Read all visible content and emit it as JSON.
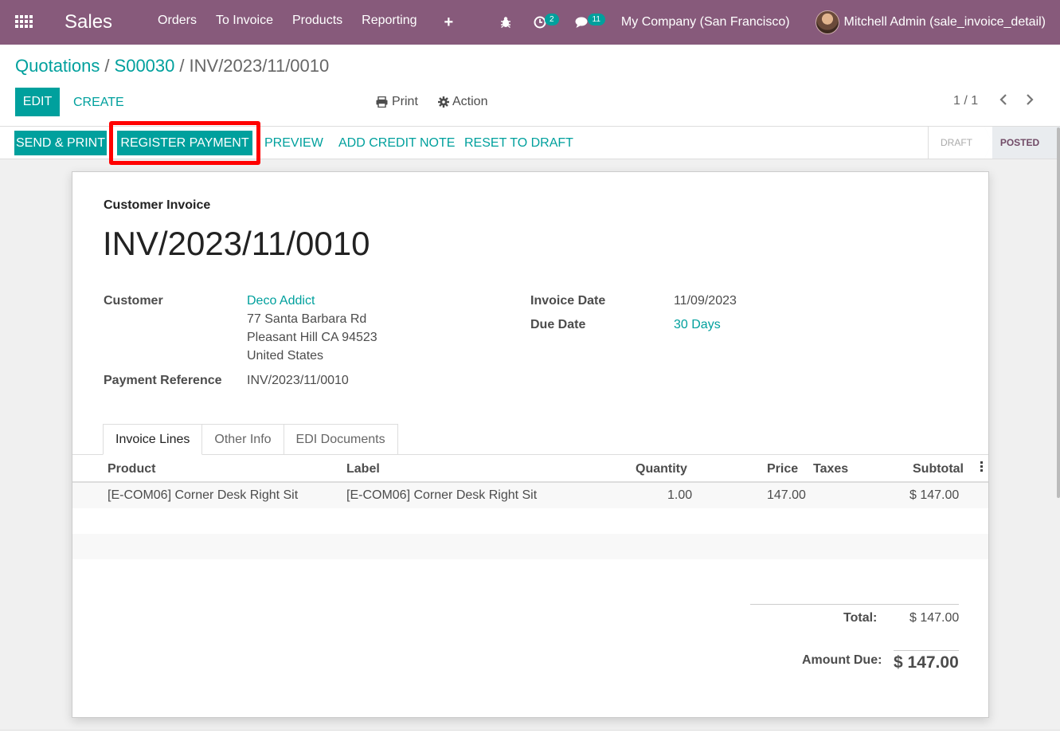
{
  "navbar": {
    "app_name": "Sales",
    "menu": [
      "Orders",
      "To Invoice",
      "Products",
      "Reporting"
    ],
    "plus": "+",
    "activity_count": "2",
    "message_count": "11",
    "company": "My Company (San Francisco)",
    "user": "Mitchell Admin (sale_invoice_detail)",
    "color": "#875a7b"
  },
  "breadcrumb": {
    "items": [
      "Quotations",
      "S00030"
    ],
    "current": "INV/2023/11/0010"
  },
  "control": {
    "edit_label": "EDIT",
    "create_label": "CREATE",
    "print_label": "Print",
    "action_label": "Action",
    "pager": "1 / 1"
  },
  "statusbar": {
    "send_print": "SEND & PRINT",
    "register_payment": "REGISTER PAYMENT",
    "preview": "PREVIEW",
    "add_credit_note": "ADD CREDIT NOTE",
    "reset_to_draft": "RESET TO DRAFT",
    "stages": [
      "DRAFT",
      "POSTED"
    ],
    "active_stage": "POSTED",
    "accent": "#00a09d"
  },
  "invoice": {
    "type": "Customer Invoice",
    "name": "INV/2023/11/0010",
    "customer_label": "Customer",
    "customer_name": "Deco Addict",
    "customer_address": [
      "77 Santa Barbara Rd",
      "Pleasant Hill CA 94523",
      "United States"
    ],
    "payment_ref_label": "Payment Reference",
    "payment_ref": "INV/2023/11/0010",
    "invoice_date_label": "Invoice Date",
    "invoice_date": "11/09/2023",
    "due_date_label": "Due Date",
    "due_date": "30 Days"
  },
  "tabs": [
    "Invoice Lines",
    "Other Info",
    "EDI Documents"
  ],
  "lines": {
    "columns": [
      "Product",
      "Label",
      "Quantity",
      "Price",
      "Taxes",
      "Subtotal"
    ],
    "rows": [
      {
        "product": "[E-COM06] Corner Desk Right Sit",
        "label": "[E-COM06] Corner Desk Right Sit",
        "quantity": "1.00",
        "price": "147.00",
        "taxes": "",
        "subtotal": "$ 147.00"
      }
    ]
  },
  "totals": {
    "total_label": "Total:",
    "total": "$ 147.00",
    "amount_due_label": "Amount Due:",
    "amount_due": "$ 147.00"
  }
}
